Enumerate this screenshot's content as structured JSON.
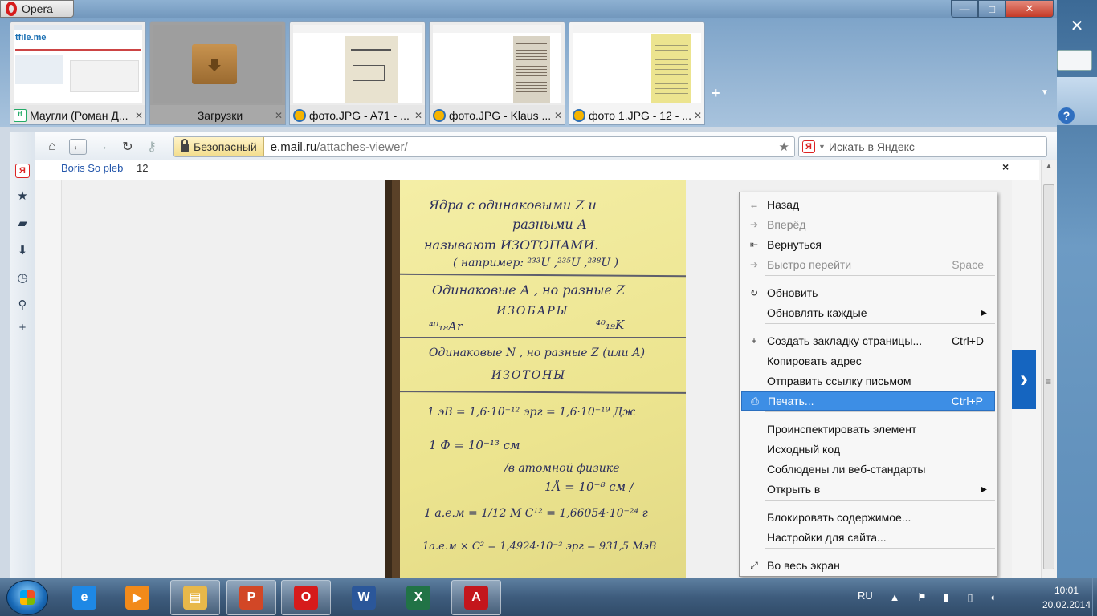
{
  "window": {
    "app_name": "Opera",
    "controls": {
      "minimize": "—",
      "maximize": "□",
      "close": "✕"
    }
  },
  "tabs": [
    {
      "title": "Маугли (Роман Д...",
      "icon": "tfile-icon",
      "close": "✕",
      "thumb_text": "tfile.me"
    },
    {
      "title": "Загрузки",
      "icon": "downloads-box-icon",
      "close": "✕",
      "thumb_text": ""
    },
    {
      "title": "фото.JPG - A71 - ...",
      "icon": "mail-ru-icon",
      "close": "✕",
      "thumb_text": ""
    },
    {
      "title": "фото.JPG - Klaus ...",
      "icon": "mail-ru-icon",
      "close": "✕",
      "thumb_text": ""
    },
    {
      "title": "фото 1.JPG - 12 - ...",
      "icon": "mail-ru-icon",
      "close": "✕",
      "thumb_text": ""
    }
  ],
  "new_tab": "+",
  "toolbar": {
    "security_label": "Безопасный",
    "url_domain": "e.mail.ru",
    "url_path": "/attaches-viewer/",
    "search_placeholder": "Искать в Яндекс"
  },
  "page": {
    "sender": "Boris So pleb",
    "count": "12",
    "close": "×",
    "next": "›"
  },
  "note": {
    "lines": [
      "Ядра  с  одинаковыми  Z  и",
      "разными   А",
      "называют   ИЗОТОПАМИ.",
      "( например:  ²³³U ,²³⁵U ,²³⁸U )",
      "Одинаковые  А , но разные  Z",
      "ИЗОБАРЫ",
      "⁴⁰₁₈Ar",
      "⁴⁰₁₉K",
      "Одинаковые  N , но разные  Z (или А)",
      "ИЗОТОНЫ",
      "1 эВ = 1,6·10⁻¹² эрг  = 1,6·10⁻¹⁹ Дж",
      "1 Ф = 10⁻¹³ см",
      "/в атомной  физике",
      "1Å = 10⁻⁸ см /",
      "1 а.е.м = 1/12 M C¹² = 1,66054·10⁻²⁴ г",
      "1а.е.м × C² = 1,4924·10⁻³ эрг = 931,5 МэВ"
    ]
  },
  "context_menu": [
    {
      "label": "Назад",
      "shortcut": "",
      "icon": "←",
      "disabled": false,
      "submenu": false
    },
    {
      "label": "Вперёд",
      "shortcut": "",
      "icon": "➔",
      "disabled": true,
      "submenu": false
    },
    {
      "label": "Вернуться",
      "shortcut": "",
      "icon": "⇤",
      "disabled": false,
      "submenu": false
    },
    {
      "label": "Быстро перейти",
      "shortcut": "Space",
      "icon": "➔",
      "disabled": true,
      "submenu": false
    },
    {
      "label": "Обновить",
      "shortcut": "",
      "icon": "↻",
      "disabled": false,
      "submenu": false
    },
    {
      "label": "Обновлять каждые",
      "shortcut": "",
      "icon": "",
      "disabled": false,
      "submenu": true
    },
    {
      "label": "Создать закладку страницы...",
      "shortcut": "Ctrl+D",
      "icon": "+",
      "disabled": false,
      "submenu": false
    },
    {
      "label": "Копировать адрес",
      "shortcut": "",
      "icon": "",
      "disabled": false,
      "submenu": false
    },
    {
      "label": "Отправить ссылку письмом",
      "shortcut": "",
      "icon": "",
      "disabled": false,
      "submenu": false
    },
    {
      "label": "Печать...",
      "shortcut": "Ctrl+P",
      "icon": "⎙",
      "disabled": false,
      "submenu": false,
      "highlighted": true
    },
    {
      "label": "Проинспектировать элемент",
      "shortcut": "",
      "icon": "",
      "disabled": false,
      "submenu": false
    },
    {
      "label": "Исходный код",
      "shortcut": "",
      "icon": "",
      "disabled": false,
      "submenu": false
    },
    {
      "label": "Соблюдены ли веб-стандарты",
      "shortcut": "",
      "icon": "",
      "disabled": false,
      "submenu": false
    },
    {
      "label": "Открыть в",
      "shortcut": "",
      "icon": "",
      "disabled": false,
      "submenu": true
    },
    {
      "label": "Блокировать содержимое...",
      "shortcut": "",
      "icon": "",
      "disabled": false,
      "submenu": false
    },
    {
      "label": "Настройки для сайта...",
      "shortcut": "",
      "icon": "",
      "disabled": false,
      "submenu": false
    },
    {
      "label": "Во весь экран",
      "shortcut": "",
      "icon": "⤢",
      "disabled": false,
      "submenu": false
    }
  ],
  "taskbar": {
    "apps": [
      {
        "name": "internet-explorer",
        "glyph": "e",
        "color": "#1e88e5"
      },
      {
        "name": "media-player",
        "glyph": "▶",
        "color": "#f28a1a"
      },
      {
        "name": "explorer",
        "glyph": "▤",
        "color": "#e8b84a"
      },
      {
        "name": "powerpoint",
        "glyph": "P",
        "color": "#d24726"
      },
      {
        "name": "opera",
        "glyph": "O",
        "color": "#d61b1b"
      },
      {
        "name": "word",
        "glyph": "W",
        "color": "#2b579a"
      },
      {
        "name": "excel",
        "glyph": "X",
        "color": "#217346"
      },
      {
        "name": "acrobat",
        "glyph": "A",
        "color": "#c4161c"
      }
    ],
    "language": "RU",
    "time": "10:01",
    "date": "20.02.2014"
  }
}
